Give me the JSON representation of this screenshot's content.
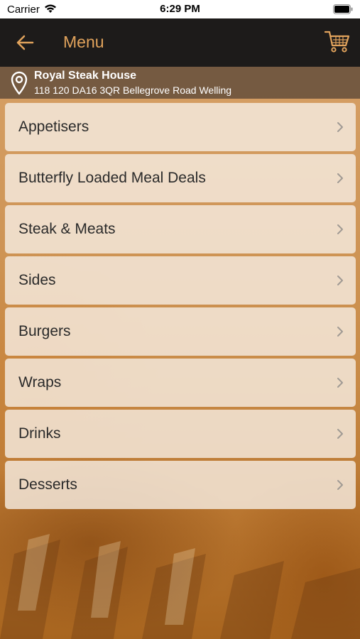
{
  "status_bar": {
    "carrier": "Carrier",
    "time": "6:29 PM"
  },
  "nav": {
    "title": "Menu",
    "back_icon": "arrow-left-icon",
    "cart_icon": "cart-icon",
    "accent_color": "#e1a35c",
    "bar_color": "#1d1b1a"
  },
  "location": {
    "name": "Royal Steak House",
    "address": "118 120 DA16 3QR Bellegrove Road Welling",
    "icon": "location-pin-icon"
  },
  "menu": {
    "items": [
      {
        "label": "Appetisers"
      },
      {
        "label": "Butterfly Loaded Meal Deals"
      },
      {
        "label": "Steak & Meats"
      },
      {
        "label": "Sides"
      },
      {
        "label": "Burgers"
      },
      {
        "label": "Wraps"
      },
      {
        "label": "Drinks"
      },
      {
        "label": "Desserts"
      }
    ],
    "chevron_icon": "chevron-right-icon"
  }
}
